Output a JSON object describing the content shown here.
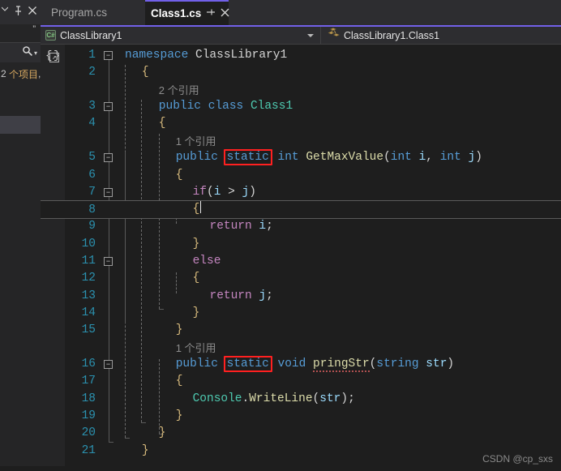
{
  "window": {
    "theme_bg": "#1e1e1e",
    "chrome_bg": "#2d2d30",
    "accent": "#7160e8"
  },
  "left_dock": {
    "pin_icon": "pin-icon",
    "close_icon": "close-icon",
    "chevron_icon": "chevron-down-icon",
    "quote_mark": "”",
    "search_icon": "search-icon",
    "search_caret": "▾",
    "item_count_num": "2",
    "item_count_label": "个项目",
    "item_count_trailing": ","
  },
  "tabs": [
    {
      "label": "Program.cs",
      "active": false
    },
    {
      "label": "Class1.cs",
      "active": true,
      "pin_glyph": "─▫",
      "close_glyph": "✕"
    }
  ],
  "navbar": {
    "project_icon": "csharp-file-icon",
    "project_icon_text": "C#",
    "project_label": "ClassLibrary1",
    "dropdown_caret": "chevron-down-icon",
    "member_icon": "class-icon",
    "member_label": "ClassLibrary1.Class1"
  },
  "editor": {
    "block_icon": "code-block-expand-icon",
    "current_line": 8,
    "total_lines": 21,
    "fold_lines": [
      1,
      3,
      5,
      7,
      11,
      16
    ],
    "lines": [
      {
        "n": "1",
        "indent": 0,
        "fold": "minus",
        "tokens": [
          {
            "t": "namespace",
            "c": "kw"
          },
          {
            "t": " ",
            "c": "plain"
          },
          {
            "t": "ClassLibrary1",
            "c": "plain"
          }
        ]
      },
      {
        "n": "2",
        "indent": 1,
        "tokens": [
          {
            "t": "{",
            "c": "brc"
          }
        ]
      },
      {
        "n": "",
        "indent": 2,
        "codelens": true,
        "lens_count": "2",
        "lens_label": "个引用"
      },
      {
        "n": "3",
        "indent": 2,
        "fold": "minus",
        "tokens": [
          {
            "t": "public",
            "c": "kw"
          },
          {
            "t": " ",
            "c": "plain"
          },
          {
            "t": "class",
            "c": "kw"
          },
          {
            "t": " ",
            "c": "plain"
          },
          {
            "t": "Class1",
            "c": "type"
          }
        ]
      },
      {
        "n": "4",
        "indent": 2,
        "tokens": [
          {
            "t": "{",
            "c": "brc"
          }
        ]
      },
      {
        "n": "",
        "indent": 3,
        "codelens": true,
        "lens_count": "1",
        "lens_label": "个引用"
      },
      {
        "n": "5",
        "indent": 3,
        "fold": "minus",
        "tokens": [
          {
            "t": "public",
            "c": "kw"
          },
          {
            "t": " ",
            "c": "plain"
          },
          {
            "t": "static",
            "c": "kw",
            "box": true
          },
          {
            "t": " ",
            "c": "plain"
          },
          {
            "t": "int",
            "c": "kw"
          },
          {
            "t": " ",
            "c": "plain"
          },
          {
            "t": "GetMaxValue",
            "c": "mth"
          },
          {
            "t": "(",
            "c": "plain"
          },
          {
            "t": "int",
            "c": "kw"
          },
          {
            "t": " ",
            "c": "plain"
          },
          {
            "t": "i",
            "c": "id"
          },
          {
            "t": ", ",
            "c": "plain"
          },
          {
            "t": "int",
            "c": "kw"
          },
          {
            "t": " ",
            "c": "plain"
          },
          {
            "t": "j",
            "c": "id"
          },
          {
            "t": ")",
            "c": "plain"
          }
        ]
      },
      {
        "n": "6",
        "indent": 3,
        "tokens": [
          {
            "t": "{",
            "c": "brc"
          }
        ]
      },
      {
        "n": "7",
        "indent": 4,
        "fold": "minus",
        "tokens": [
          {
            "t": "if",
            "c": "ctrl"
          },
          {
            "t": "(",
            "c": "plain"
          },
          {
            "t": "i",
            "c": "id"
          },
          {
            "t": " > ",
            "c": "op"
          },
          {
            "t": "j",
            "c": "id"
          },
          {
            "t": ")",
            "c": "plain"
          }
        ]
      },
      {
        "n": "8",
        "indent": 4,
        "current": true,
        "caret": true,
        "tokens": [
          {
            "t": "{",
            "c": "brc"
          }
        ]
      },
      {
        "n": "9",
        "indent": 5,
        "tokens": [
          {
            "t": "return",
            "c": "ctrl"
          },
          {
            "t": " ",
            "c": "plain"
          },
          {
            "t": "i",
            "c": "id"
          },
          {
            "t": ";",
            "c": "plain"
          }
        ]
      },
      {
        "n": "10",
        "indent": 4,
        "tokens": [
          {
            "t": "}",
            "c": "brc"
          }
        ]
      },
      {
        "n": "11",
        "indent": 4,
        "fold": "minus",
        "tokens": [
          {
            "t": "else",
            "c": "ctrl"
          }
        ]
      },
      {
        "n": "12",
        "indent": 4,
        "tokens": [
          {
            "t": "{",
            "c": "brc"
          }
        ]
      },
      {
        "n": "13",
        "indent": 5,
        "tokens": [
          {
            "t": "return",
            "c": "ctrl"
          },
          {
            "t": " ",
            "c": "plain"
          },
          {
            "t": "j",
            "c": "id"
          },
          {
            "t": ";",
            "c": "plain"
          }
        ]
      },
      {
        "n": "14",
        "indent": 4,
        "tokens": [
          {
            "t": "}",
            "c": "brc"
          }
        ]
      },
      {
        "n": "15",
        "indent": 3,
        "tokens": [
          {
            "t": "}",
            "c": "brc"
          }
        ]
      },
      {
        "n": "",
        "indent": 3,
        "codelens": true,
        "lens_count": "1",
        "lens_label": "个引用"
      },
      {
        "n": "16",
        "indent": 3,
        "fold": "minus",
        "tokens": [
          {
            "t": "public",
            "c": "kw"
          },
          {
            "t": " ",
            "c": "plain"
          },
          {
            "t": "static",
            "c": "kw",
            "box": true
          },
          {
            "t": " ",
            "c": "plain"
          },
          {
            "t": "void",
            "c": "kw"
          },
          {
            "t": " ",
            "c": "plain"
          },
          {
            "t": "pringStr",
            "c": "mth",
            "squiggle": true
          },
          {
            "t": "(",
            "c": "plain"
          },
          {
            "t": "string",
            "c": "kw"
          },
          {
            "t": " ",
            "c": "plain"
          },
          {
            "t": "str",
            "c": "id"
          },
          {
            "t": ")",
            "c": "plain"
          }
        ]
      },
      {
        "n": "17",
        "indent": 3,
        "tokens": [
          {
            "t": "{",
            "c": "brc"
          }
        ]
      },
      {
        "n": "18",
        "indent": 4,
        "tokens": [
          {
            "t": "Console",
            "c": "type"
          },
          {
            "t": ".",
            "c": "plain"
          },
          {
            "t": "WriteLine",
            "c": "mth"
          },
          {
            "t": "(",
            "c": "plain"
          },
          {
            "t": "str",
            "c": "id"
          },
          {
            "t": ")",
            "c": "plain"
          },
          {
            "t": ";",
            "c": "plain"
          }
        ]
      },
      {
        "n": "19",
        "indent": 3,
        "tokens": [
          {
            "t": "}",
            "c": "brc"
          }
        ]
      },
      {
        "n": "20",
        "indent": 2,
        "tokens": [
          {
            "t": "}",
            "c": "brc"
          }
        ]
      },
      {
        "n": "21",
        "indent": 1,
        "tokens": [
          {
            "t": "}",
            "c": "brc"
          }
        ]
      }
    ]
  },
  "watermark": {
    "text": "CSDN @cp_sxs"
  }
}
